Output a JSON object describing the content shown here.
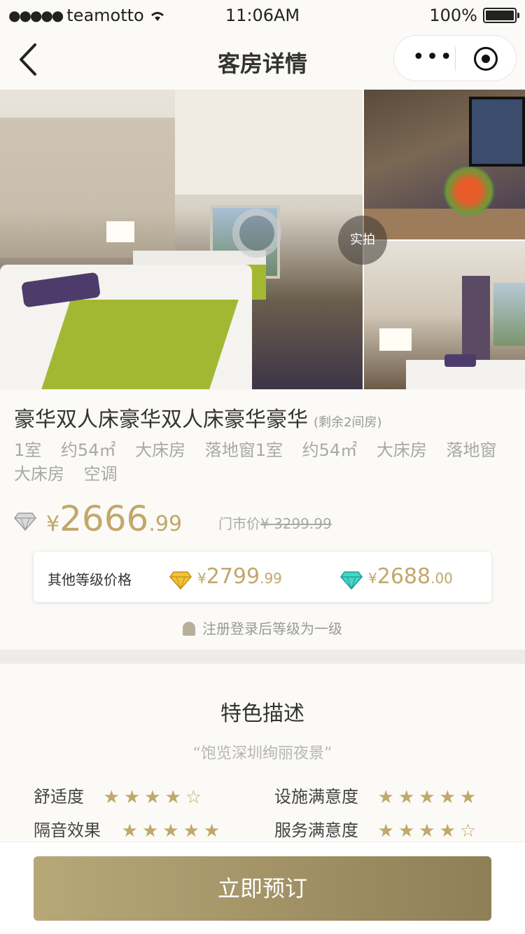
{
  "status_bar": {
    "signal_dots": "●●●●●",
    "carrier": "teamotto",
    "time": "11:06AM",
    "battery": "100%"
  },
  "nav": {
    "title": "客房详情",
    "more_label": "•••"
  },
  "gallery": {
    "live_label": "实拍"
  },
  "room": {
    "title": "豪华双人床豪华双人床豪华豪华",
    "remaining": "(剩余2间房)",
    "tags": [
      "1室",
      "约54㎡",
      "大床房",
      "落地窗1室",
      "约54㎡",
      "大床房",
      "落地窗",
      "大床房",
      "空调"
    ]
  },
  "price": {
    "currency": "¥",
    "integer": "2666",
    "decimal": ".99",
    "market_label": "门市价",
    "market_price": "¥ 3299.99",
    "member_level_icon": "silver-diamond-icon"
  },
  "levels": {
    "label": "其他等级价格",
    "items": [
      {
        "icon": "gold-diamond-icon",
        "color": "#e6b22e",
        "currency": "¥",
        "integer": "2799",
        "decimal": ".99"
      },
      {
        "icon": "teal-diamond-icon",
        "color": "#35c4b8",
        "currency": "¥",
        "integer": "2688",
        "decimal": ".00"
      }
    ]
  },
  "hint": "注册登录后等级为一级",
  "features": {
    "title": "特色描述",
    "quote": "“饱览深圳绚丽夜景”",
    "ratings": [
      {
        "label": "舒适度",
        "stars": "★★★★☆",
        "value": 4
      },
      {
        "label": "设施满意度",
        "stars": "★★★★★",
        "value": 5
      },
      {
        "label": "隔音效果",
        "stars": "★★★★★",
        "value": 5
      },
      {
        "label": "服务满意度",
        "stars": "★★★★☆",
        "value": 4
      }
    ]
  },
  "book_button": "立即预订",
  "colors": {
    "accent_gold": "#c1a86b",
    "button_gradient_start": "#b8a878",
    "button_gradient_end": "#8f7f57"
  }
}
